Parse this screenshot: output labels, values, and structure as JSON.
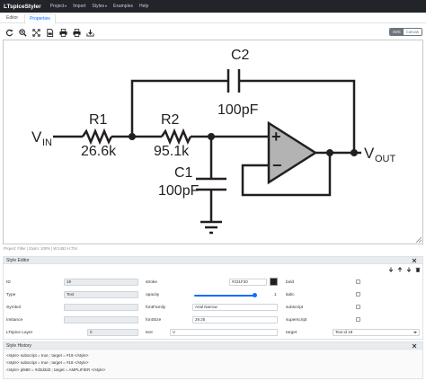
{
  "navbar": {
    "brand": "LTspiceStyler",
    "items": [
      {
        "label": "Project",
        "dropdown": true
      },
      {
        "label": "Import",
        "dropdown": false
      },
      {
        "label": "Styles",
        "dropdown": true
      },
      {
        "label": "Examples",
        "dropdown": false
      },
      {
        "label": "Help",
        "dropdown": false
      }
    ]
  },
  "tabs": [
    {
      "label": "Editor",
      "active": false
    },
    {
      "label": "Properties",
      "active": true
    }
  ],
  "toolbar": {
    "buttons": [
      "refresh-icon",
      "zoom-in-icon",
      "fit-screen-icon",
      "pdf-file-icon",
      "print-icon",
      "print-alt-icon",
      "download-icon"
    ]
  },
  "view_toggle": {
    "svg": "SVG",
    "canvas": "Canvas"
  },
  "schematic": {
    "labels": {
      "c2": "C2",
      "c2_value": "100pF",
      "r1": "R1",
      "r1_value": "26.6k",
      "r2": "R2",
      "r2_value": "95.1k",
      "c1": "C1",
      "c1_value": "100pF",
      "vin": "V",
      "vin_sub": "IN",
      "vout": "V",
      "vout_sub": "OUT",
      "plus": "+",
      "minus": "−"
    }
  },
  "status": "Project: Filter  |  Zoom: 100%  |  W:1453  H:704",
  "style_editor": {
    "title": "Style Editor",
    "fields": {
      "id_label": "ID",
      "id_value": "19",
      "type_label": "Type",
      "type_value": "Text",
      "symbol_label": "Symbol",
      "symbol_value": "",
      "instance_label": "Instance",
      "instance_value": "",
      "layer_label": "LTspice Layer",
      "layer_value": "0",
      "stroke_label": "stroke",
      "stroke_value": "#231F20",
      "opacity_label": "opacity",
      "opacity_value": "1",
      "fontfamily_label": "fontFamily",
      "fontfamily_value": "Arial Narrow",
      "fontsize_label": "fontSize",
      "fontsize_value": "29.25",
      "text_label": "text",
      "text_value": "V",
      "bold_label": "bold",
      "italic_label": "italic",
      "subscript_label": "subscript",
      "superscript_label": "superscript",
      "target_label": "target",
      "target_value": "Text id 19"
    }
  },
  "style_history": {
    "title": "Style History",
    "lines": [
      "<style> subscript = true ; target = #19 </style>",
      "<style> subscript = true ; target = #18 </style>",
      "<style> pl580 = #d3d3d3 ; target = AMPLIFIER </style>"
    ]
  },
  "colors": {
    "navbar": "#212529",
    "accent": "#0d6efd",
    "stroke": "#231F20"
  }
}
